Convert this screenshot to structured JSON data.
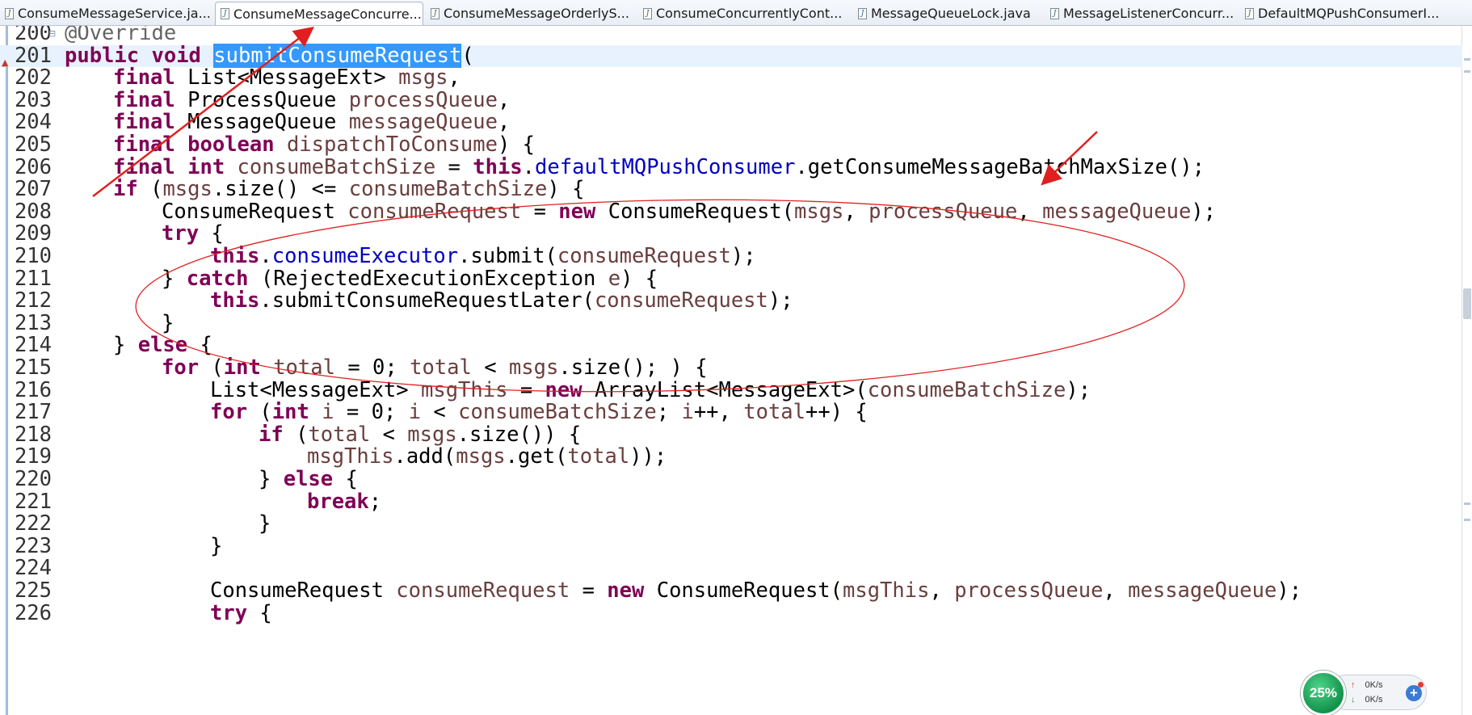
{
  "tabs": [
    {
      "label": "ConsumeMessageService.ja...",
      "icon": "java-file-icon",
      "active": false,
      "closable": true
    },
    {
      "label": "ConsumeMessageConcurre...",
      "icon": "java-file-icon",
      "active": true,
      "closable": true
    },
    {
      "label": "ConsumeMessageOrderlyS...",
      "icon": "java-file-icon",
      "active": false,
      "closable": false
    },
    {
      "label": "ConsumeConcurrentlyCont...",
      "icon": "java-file-icon",
      "active": false,
      "closable": false
    },
    {
      "label": "MessageQueueLock.java",
      "icon": "java-file-icon",
      "active": false,
      "closable": false
    },
    {
      "label": "MessageListenerConcurr...",
      "icon": "java-file-icon",
      "active": false,
      "closable": false
    },
    {
      "label": "DefaultMQPushConsumerI...",
      "icon": "java-file-icon",
      "active": false,
      "closable": false
    }
  ],
  "tab_close_glyph": "⊠",
  "editor": {
    "current_line": 201,
    "lines": [
      {
        "n": "200",
        "indent": 1,
        "tokens": [
          [
            "ann",
            "@Override"
          ]
        ]
      },
      {
        "n": "201",
        "indent": 1,
        "tokens": [
          [
            "kw",
            "public"
          ],
          [
            "",
            " "
          ],
          [
            "kw",
            "void"
          ],
          [
            "",
            " "
          ],
          [
            "sel",
            "submitConsumeRequest"
          ],
          [
            "",
            "("
          ]
        ]
      },
      {
        "n": "202",
        "indent": 2,
        "tokens": [
          [
            "kw",
            "final"
          ],
          [
            "",
            " List<MessageExt> "
          ],
          [
            "var",
            "msgs"
          ],
          [
            "",
            ","
          ]
        ]
      },
      {
        "n": "203",
        "indent": 2,
        "tokens": [
          [
            "kw",
            "final"
          ],
          [
            "",
            " ProcessQueue "
          ],
          [
            "var",
            "processQueue"
          ],
          [
            "",
            ","
          ]
        ]
      },
      {
        "n": "204",
        "indent": 2,
        "tokens": [
          [
            "kw",
            "final"
          ],
          [
            "",
            " MessageQueue "
          ],
          [
            "var",
            "messageQueue"
          ],
          [
            "",
            ","
          ]
        ]
      },
      {
        "n": "205",
        "indent": 2,
        "tokens": [
          [
            "kw",
            "final"
          ],
          [
            "",
            " "
          ],
          [
            "kw",
            "boolean"
          ],
          [
            "",
            " "
          ],
          [
            "var",
            "dispatchToConsume"
          ],
          [
            "",
            ") {"
          ]
        ]
      },
      {
        "n": "206",
        "indent": 2,
        "tokens": [
          [
            "kw",
            "final"
          ],
          [
            "",
            " "
          ],
          [
            "kw",
            "int"
          ],
          [
            "",
            " "
          ],
          [
            "var",
            "consumeBatchSize"
          ],
          [
            "",
            " = "
          ],
          [
            "kw",
            "this"
          ],
          [
            "",
            "."
          ],
          [
            "fld",
            "defaultMQPushConsumer"
          ],
          [
            "",
            ".getConsumeMessageBatchMaxSize();"
          ]
        ]
      },
      {
        "n": "207",
        "indent": 2,
        "tokens": [
          [
            "kw",
            "if"
          ],
          [
            "",
            " ("
          ],
          [
            "var",
            "msgs"
          ],
          [
            "",
            ".size() <= "
          ],
          [
            "var",
            "consumeBatchSize"
          ],
          [
            "",
            ") {"
          ]
        ]
      },
      {
        "n": "208",
        "indent": 3,
        "tokens": [
          [
            "",
            "ConsumeRequest "
          ],
          [
            "var",
            "consumeRequest"
          ],
          [
            "",
            " = "
          ],
          [
            "kw",
            "new"
          ],
          [
            "",
            " ConsumeRequest("
          ],
          [
            "var",
            "msgs"
          ],
          [
            "",
            ", "
          ],
          [
            "var",
            "processQueue"
          ],
          [
            "",
            ", "
          ],
          [
            "var",
            "messageQueue"
          ],
          [
            "",
            ");"
          ]
        ]
      },
      {
        "n": "209",
        "indent": 3,
        "tokens": [
          [
            "kw",
            "try"
          ],
          [
            "",
            " {"
          ]
        ]
      },
      {
        "n": "210",
        "indent": 4,
        "tokens": [
          [
            "kw",
            "this"
          ],
          [
            "",
            "."
          ],
          [
            "fld",
            "consumeExecutor"
          ],
          [
            "",
            ".submit("
          ],
          [
            "var",
            "consumeRequest"
          ],
          [
            "",
            ");"
          ]
        ]
      },
      {
        "n": "211",
        "indent": 3,
        "tokens": [
          [
            "",
            "} "
          ],
          [
            "kw",
            "catch"
          ],
          [
            "",
            " (RejectedExecutionException "
          ],
          [
            "var",
            "e"
          ],
          [
            "",
            ") {"
          ]
        ]
      },
      {
        "n": "212",
        "indent": 4,
        "tokens": [
          [
            "kw",
            "this"
          ],
          [
            "",
            ".submitConsumeRequestLater("
          ],
          [
            "var",
            "consumeRequest"
          ],
          [
            "",
            ");"
          ]
        ]
      },
      {
        "n": "213",
        "indent": 3,
        "tokens": [
          [
            "",
            "}"
          ]
        ]
      },
      {
        "n": "214",
        "indent": 2,
        "tokens": [
          [
            "",
            "} "
          ],
          [
            "kw",
            "else"
          ],
          [
            "",
            " {"
          ]
        ]
      },
      {
        "n": "215",
        "indent": 3,
        "tokens": [
          [
            "kw",
            "for"
          ],
          [
            "",
            " ("
          ],
          [
            "kw",
            "int"
          ],
          [
            "",
            " "
          ],
          [
            "var",
            "total"
          ],
          [
            "",
            " = 0; "
          ],
          [
            "var",
            "total"
          ],
          [
            "",
            " < "
          ],
          [
            "var",
            "msgs"
          ],
          [
            "",
            ".size(); ) {"
          ]
        ]
      },
      {
        "n": "216",
        "indent": 4,
        "tokens": [
          [
            "",
            "List<MessageExt> "
          ],
          [
            "var",
            "msgThis"
          ],
          [
            "",
            " = "
          ],
          [
            "kw",
            "new"
          ],
          [
            "",
            " ArrayList<MessageExt>("
          ],
          [
            "var",
            "consumeBatchSize"
          ],
          [
            "",
            ");"
          ]
        ]
      },
      {
        "n": "217",
        "indent": 4,
        "tokens": [
          [
            "kw",
            "for"
          ],
          [
            "",
            " ("
          ],
          [
            "kw",
            "int"
          ],
          [
            "",
            " "
          ],
          [
            "var",
            "i"
          ],
          [
            "",
            " = 0; "
          ],
          [
            "var",
            "i"
          ],
          [
            "",
            " < "
          ],
          [
            "var",
            "consumeBatchSize"
          ],
          [
            "",
            "; "
          ],
          [
            "var",
            "i"
          ],
          [
            "",
            "++, "
          ],
          [
            "var",
            "total"
          ],
          [
            "",
            "++) {"
          ]
        ]
      },
      {
        "n": "218",
        "indent": 5,
        "tokens": [
          [
            "kw",
            "if"
          ],
          [
            "",
            " ("
          ],
          [
            "var",
            "total"
          ],
          [
            "",
            " < "
          ],
          [
            "var",
            "msgs"
          ],
          [
            "",
            ".size()) {"
          ]
        ]
      },
      {
        "n": "219",
        "indent": 6,
        "tokens": [
          [
            "var",
            "msgThis"
          ],
          [
            "",
            ".add("
          ],
          [
            "var",
            "msgs"
          ],
          [
            "",
            ".get("
          ],
          [
            "var",
            "total"
          ],
          [
            "",
            "));"
          ]
        ]
      },
      {
        "n": "220",
        "indent": 5,
        "tokens": [
          [
            "",
            "} "
          ],
          [
            "kw",
            "else"
          ],
          [
            "",
            " {"
          ]
        ]
      },
      {
        "n": "221",
        "indent": 6,
        "tokens": [
          [
            "kw",
            "break"
          ],
          [
            "",
            ";"
          ]
        ]
      },
      {
        "n": "222",
        "indent": 5,
        "tokens": [
          [
            "",
            "}"
          ]
        ]
      },
      {
        "n": "223",
        "indent": 4,
        "tokens": [
          [
            "",
            "}"
          ]
        ]
      },
      {
        "n": "224",
        "indent": 0,
        "tokens": []
      },
      {
        "n": "225",
        "indent": 4,
        "tokens": [
          [
            "",
            "ConsumeRequest "
          ],
          [
            "var",
            "consumeRequest"
          ],
          [
            "",
            " = "
          ],
          [
            "kw",
            "new"
          ],
          [
            "",
            " ConsumeRequest("
          ],
          [
            "var",
            "msgThis"
          ],
          [
            "",
            ", "
          ],
          [
            "var",
            "processQueue"
          ],
          [
            "",
            ", "
          ],
          [
            "var",
            "messageQueue"
          ],
          [
            "",
            ");"
          ]
        ]
      },
      {
        "n": "226",
        "indent": 4,
        "tokens": [
          [
            "kw",
            "try"
          ],
          [
            "",
            " {"
          ]
        ]
      }
    ]
  },
  "colors": {
    "keyword": "#7f0055",
    "annotation": "#646464",
    "field": "#0000c0",
    "local_variable": "#6a3e3e",
    "selection": "#3399ff",
    "current_line": "#e8f2fe",
    "markup_red": "#e02020"
  },
  "speed_widget": {
    "percent": "25%",
    "upload": "0K/s",
    "download": "0K/s",
    "up_glyph": "↑",
    "down_glyph": "↓",
    "plus_glyph": "+"
  }
}
